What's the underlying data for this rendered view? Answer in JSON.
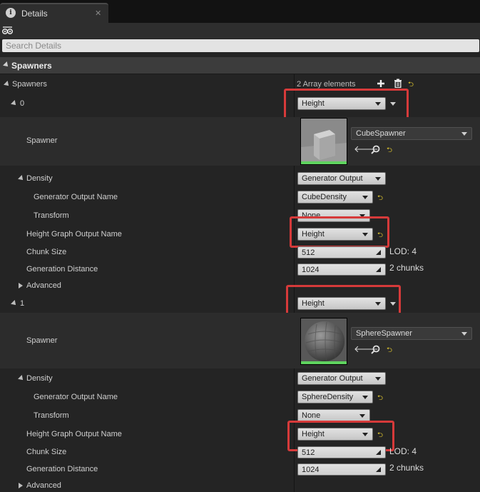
{
  "tab": {
    "title": "Details",
    "close": "✕"
  },
  "search": {
    "placeholder": "Search Details"
  },
  "category": {
    "title": "Spawners"
  },
  "spawners_header": {
    "label": "Spawners",
    "count": "2 Array elements"
  },
  "elements": [
    {
      "index": "0",
      "type_value": "Height",
      "spawner_label": "Spawner",
      "asset_name": "CubeSpawner",
      "density_label": "Density",
      "density_value": "Generator Output",
      "gen_output_name_label": "Generator Output Name",
      "gen_output_name_value": "CubeDensity",
      "transform_label": "Transform",
      "transform_value": "None",
      "height_output_label": "Height Graph Output Name",
      "height_output_value": "Height",
      "chunk_size_label": "Chunk Size",
      "chunk_size_value": "512",
      "lod_text": "LOD: 4",
      "gen_distance_label": "Generation Distance",
      "gen_distance_value": "1024",
      "chunks_text": "2 chunks",
      "advanced_label": "Advanced"
    },
    {
      "index": "1",
      "type_value": "Height",
      "spawner_label": "Spawner",
      "asset_name": "SphereSpawner",
      "density_label": "Density",
      "density_value": "Generator Output",
      "gen_output_name_label": "Generator Output Name",
      "gen_output_name_value": "SphereDensity",
      "transform_label": "Transform",
      "transform_value": "None",
      "height_output_label": "Height Graph Output Name",
      "height_output_value": "Height",
      "chunk_size_label": "Chunk Size",
      "chunk_size_value": "512",
      "lod_text": "LOD: 4",
      "gen_distance_label": "Generation Distance",
      "gen_distance_value": "1024",
      "chunks_text": "2 chunks",
      "advanced_label": "Advanced"
    }
  ],
  "colors": {
    "highlight": "#d63a3a",
    "reset_arrow": "#e6cc2e",
    "thumb_bar": "#5fd35f"
  },
  "icons": [
    "info-icon",
    "eye-icon",
    "add-icon",
    "trash-icon",
    "reset-arrow-icon",
    "browse-arrow-icon",
    "search-icon",
    "expand-arrow-icon",
    "collapse-arrow-icon",
    "dropdown-icon"
  ]
}
